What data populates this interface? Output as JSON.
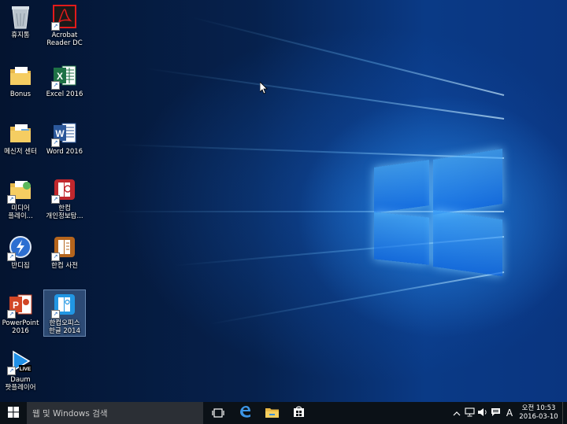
{
  "desktop": {
    "icons": [
      {
        "label": "휴지통",
        "icon": "recycle-bin-icon"
      },
      {
        "label": "Acrobat\nReader DC",
        "icon": "acrobat-reader-icon"
      },
      {
        "label": "Bonus",
        "icon": "folder-icon"
      },
      {
        "label": "Excel 2016",
        "icon": "excel-icon"
      },
      {
        "label": "메신저 센터",
        "icon": "folder-icon"
      },
      {
        "label": "Word 2016",
        "icon": "word-icon"
      },
      {
        "label": "미디어\n플레이...",
        "icon": "media-folder-icon"
      },
      {
        "label": "한컴\n개인정보탐...",
        "icon": "hancom-privacy-icon"
      },
      {
        "label": "반디집",
        "icon": "bandizip-icon"
      },
      {
        "label": "한컴 사전",
        "icon": "hancom-dictionary-icon"
      },
      {
        "label": "PowerPoint\n2016",
        "icon": "powerpoint-icon"
      },
      {
        "label": "한컴오피스\n한글 2014",
        "icon": "hancom-hangul-icon"
      },
      {
        "label": "Daum\n팟플레이어",
        "icon": "potplayer-icon"
      }
    ]
  },
  "taskbar": {
    "search_placeholder": "웹 및 Windows 검색",
    "ime_label": "A",
    "clock_ampm_time": "오전 10:53",
    "clock_date": "2016-03-10"
  },
  "colors": {
    "taskbar": "#0b1117",
    "search_box": "#2b2f35",
    "accent": "#1e90ff"
  }
}
